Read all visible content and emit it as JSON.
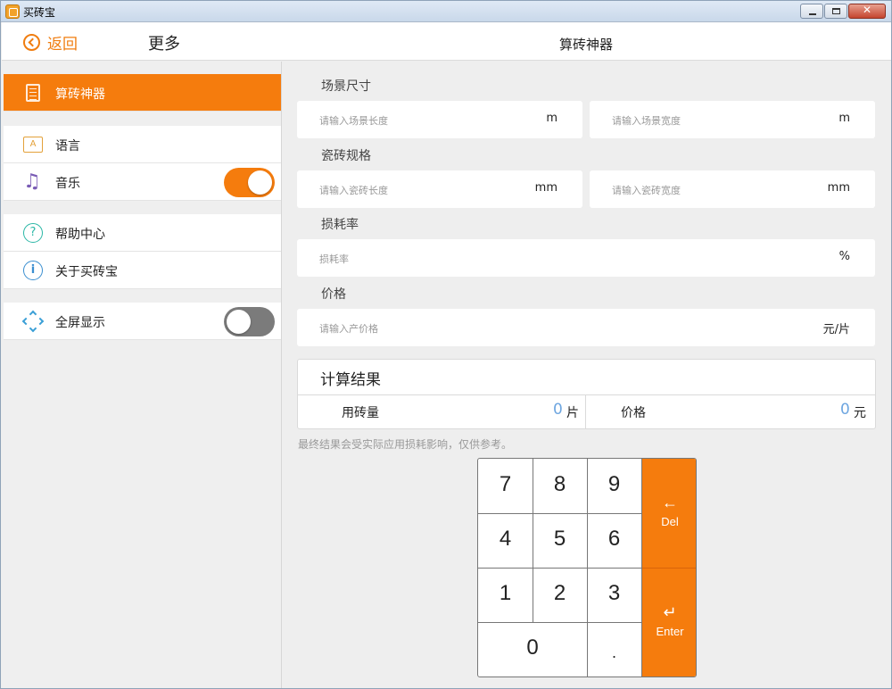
{
  "window": {
    "title": "买砖宝"
  },
  "topbar": {
    "back_label": "返回",
    "left_title": "更多",
    "center_title": "算砖神器"
  },
  "sidebar": {
    "items": [
      {
        "label": "算砖神器",
        "icon": "calculator-icon",
        "active": true
      },
      {
        "label": "语言",
        "icon": "language-icon"
      },
      {
        "label": "音乐",
        "icon": "music-icon",
        "toggle": true
      },
      {
        "label": "帮助中心",
        "icon": "help-icon"
      },
      {
        "label": "关于买砖宝",
        "icon": "info-icon"
      },
      {
        "label": "全屏显示",
        "icon": "fullscreen-icon",
        "toggle": false
      }
    ]
  },
  "form": {
    "scene": {
      "label": "场景尺寸",
      "length_placeholder": "请输入场景长度",
      "length_unit": "m",
      "width_placeholder": "请输入场景宽度",
      "width_unit": "m"
    },
    "tile": {
      "label": "瓷砖规格",
      "length_placeholder": "请输入瓷砖长度",
      "length_unit": "mm",
      "width_placeholder": "请输入瓷砖宽度",
      "width_unit": "mm"
    },
    "loss": {
      "label": "损耗率",
      "placeholder": "损耗率",
      "unit": "%"
    },
    "price": {
      "label": "价格",
      "placeholder": "请输入产价格",
      "unit": "元/片"
    }
  },
  "result": {
    "title": "计算结果",
    "tile_count_label": "用砖量",
    "tile_count_value": "0",
    "tile_count_unit": "片",
    "price_label": "价格",
    "price_value": "0",
    "price_unit": "元",
    "note": "最终结果会受实际应用损耗影响，仅供参考。"
  },
  "keypad": {
    "keys": [
      "7",
      "8",
      "9",
      "4",
      "5",
      "6",
      "1",
      "2",
      "3",
      "0",
      "."
    ],
    "del_arrow": "←",
    "del_label": "Del",
    "enter_arrow": "↵",
    "enter_label": "Enter"
  },
  "colors": {
    "accent": "#f57c0d",
    "result_value": "#6ea6e0"
  }
}
